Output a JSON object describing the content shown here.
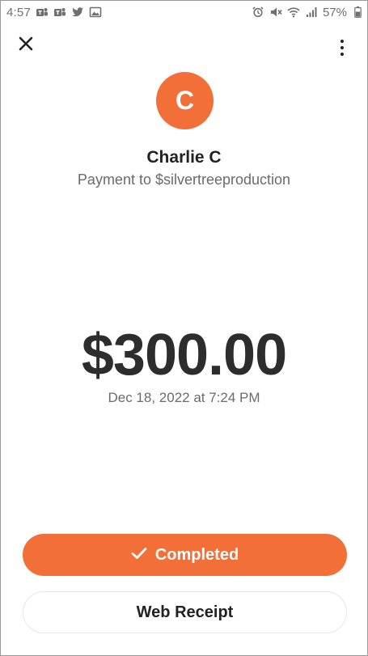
{
  "status_bar": {
    "time": "4:57",
    "battery_percent": "57%",
    "left_icons": [
      "teams-icon",
      "teams-icon",
      "twitter-icon",
      "image-icon"
    ],
    "right_icons": [
      "alarm-icon",
      "mute-icon",
      "wifi-icon",
      "signal-icon",
      "battery-icon"
    ]
  },
  "toolbar": {
    "close_icon": "close-icon",
    "more_icon": "more-vertical-icon"
  },
  "recipient": {
    "avatar_initial": "C",
    "avatar_color": "#f26f38",
    "name": "Charlie C",
    "subtitle": "Payment to $silvertreeproduction"
  },
  "payment": {
    "amount": "$300.00",
    "date": "Dec 18, 2022 at 7:24 PM"
  },
  "actions": {
    "completed_label": "Completed",
    "completed_icon": "checkmark-icon",
    "completed_color": "#f26f38",
    "receipt_label": "Web Receipt"
  }
}
